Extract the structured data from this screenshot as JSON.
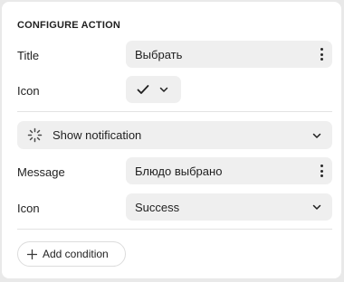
{
  "section_title": "CONFIGURE ACTION",
  "title_row": {
    "label": "Title",
    "value": "Выбрать"
  },
  "icon_row": {
    "label": "Icon",
    "icon": "check-icon"
  },
  "action": {
    "type_label": "Show notification",
    "icon": "spinner-icon"
  },
  "message_row": {
    "label": "Message",
    "value": "Блюдо выбрано"
  },
  "status_row": {
    "label": "Icon",
    "value": "Success"
  },
  "add_condition_label": "Add condition"
}
